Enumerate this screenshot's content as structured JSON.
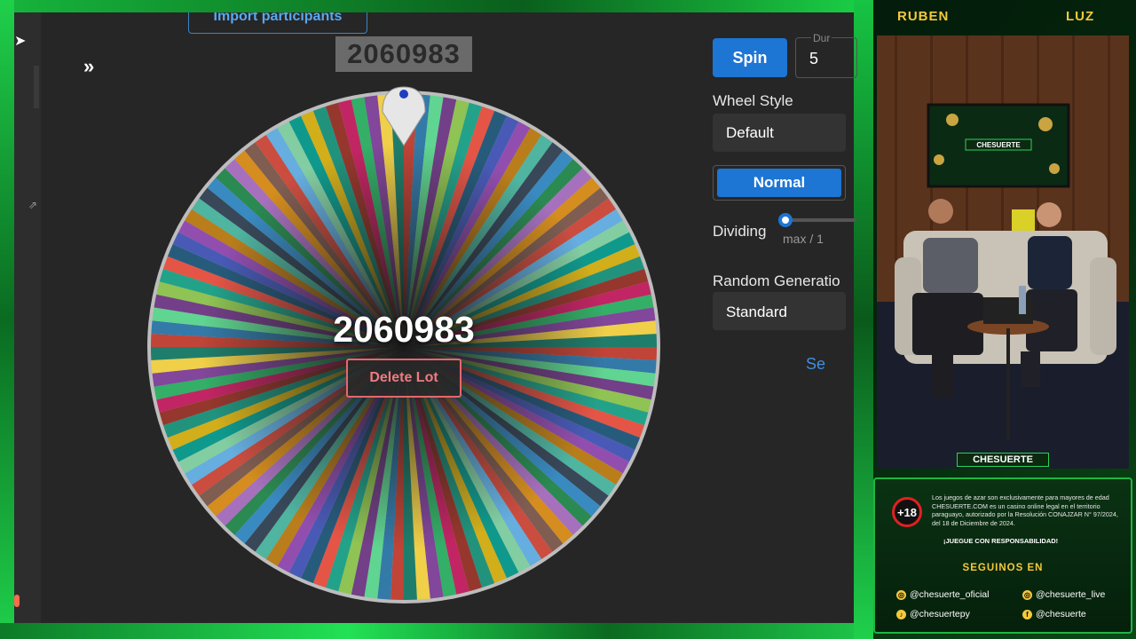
{
  "app": {
    "import_label": "Import participants",
    "expand_glyph": "»",
    "top_winner": "2060983",
    "wheel_center_value": "2060983",
    "delete_label": "Delete Lot",
    "spin_label": "Spin",
    "duration_label": "Dur",
    "duration_value": "5",
    "wheel_style_label": "Wheel Style",
    "wheel_style_value": "Default",
    "mode_label": "Normal",
    "dividing_label": "Dividing",
    "dividing_caption": "max / 1",
    "random_label": "Random Generatio",
    "random_value": "Standard",
    "settings_link": "Se"
  },
  "stream": {
    "host_left": "RUBEN",
    "host_right": "LUZ",
    "brand": "CHESUERTE",
    "age_badge": "+18",
    "legal": "Los juegos de azar son exclusivamente para mayores de edad CHESUERTE.COM es un casino online legal en el territorio paraguayo, autorizado por la Resolución CONAJZAR N° 97/2024, del 18 de Diciembre de 2024.",
    "responsible": "¡JUEGUE CON RESPONSABILIDAD!",
    "follow_title": "SEGUINOS EN",
    "socials": [
      "@chesuerte_oficial",
      "@chesuerte_live",
      "@chesuertepy",
      "@chesuerte"
    ]
  },
  "colors": {
    "accent_blue": "#1d75d4",
    "danger": "#e5676e",
    "frame_green": "#1fd04a",
    "brand_gold": "#f4c93a"
  },
  "icons": [
    "cursor-icon",
    "external-link-icon",
    "expand-icon",
    "pointer-pin-icon",
    "instagram-icon",
    "tiktok-icon",
    "facebook-icon"
  ]
}
